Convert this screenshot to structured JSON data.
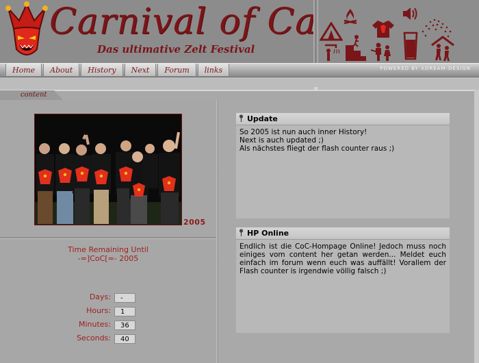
{
  "header": {
    "title": "Carnival of Carnage",
    "subtitle": "Das ultimative Zelt Festival",
    "powered_by": "POWERED BY XDREAM-DESIGN"
  },
  "nav": [
    {
      "label": "Home"
    },
    {
      "label": "About"
    },
    {
      "label": "History"
    },
    {
      "label": "Next"
    },
    {
      "label": "Forum"
    },
    {
      "label": "links"
    }
  ],
  "content_tab": "content",
  "photo": {
    "year": "2005"
  },
  "countdown": {
    "title_line1": "Time Remaining Until",
    "title_line2": "-=]CoC[=- 2005",
    "rows": [
      {
        "label": "Days:",
        "value": "-"
      },
      {
        "label": "Hours:",
        "value": "1"
      },
      {
        "label": "Minutes:",
        "value": "36"
      },
      {
        "label": "Seconds:",
        "value": "40"
      }
    ]
  },
  "news": [
    {
      "title": "Update",
      "lines": [
        "So 2005 ist nun auch inner History!",
        "Next is auch updated ;)",
        "Als nächstes fliegt der flash counter raus ;)"
      ]
    },
    {
      "title": "HP Online",
      "body": "Endlich ist die CoC-Hompage Online! Jedoch muss noch einiges vom content her getan werden... Meldet euch einfach im forum wenn euch was auffällt! Vorallem der Flash counter is irgendwie völlig falsch ;)"
    }
  ],
  "colors": {
    "brand": "#7a1518",
    "accent": "#a0201f"
  },
  "icons": [
    "tent-icon",
    "campfire-icon",
    "tshirt-icon",
    "speaker-icon",
    "shower-icon",
    "climb-icon",
    "people-icon",
    "drink-glass-icon",
    "dancers-icon"
  ]
}
